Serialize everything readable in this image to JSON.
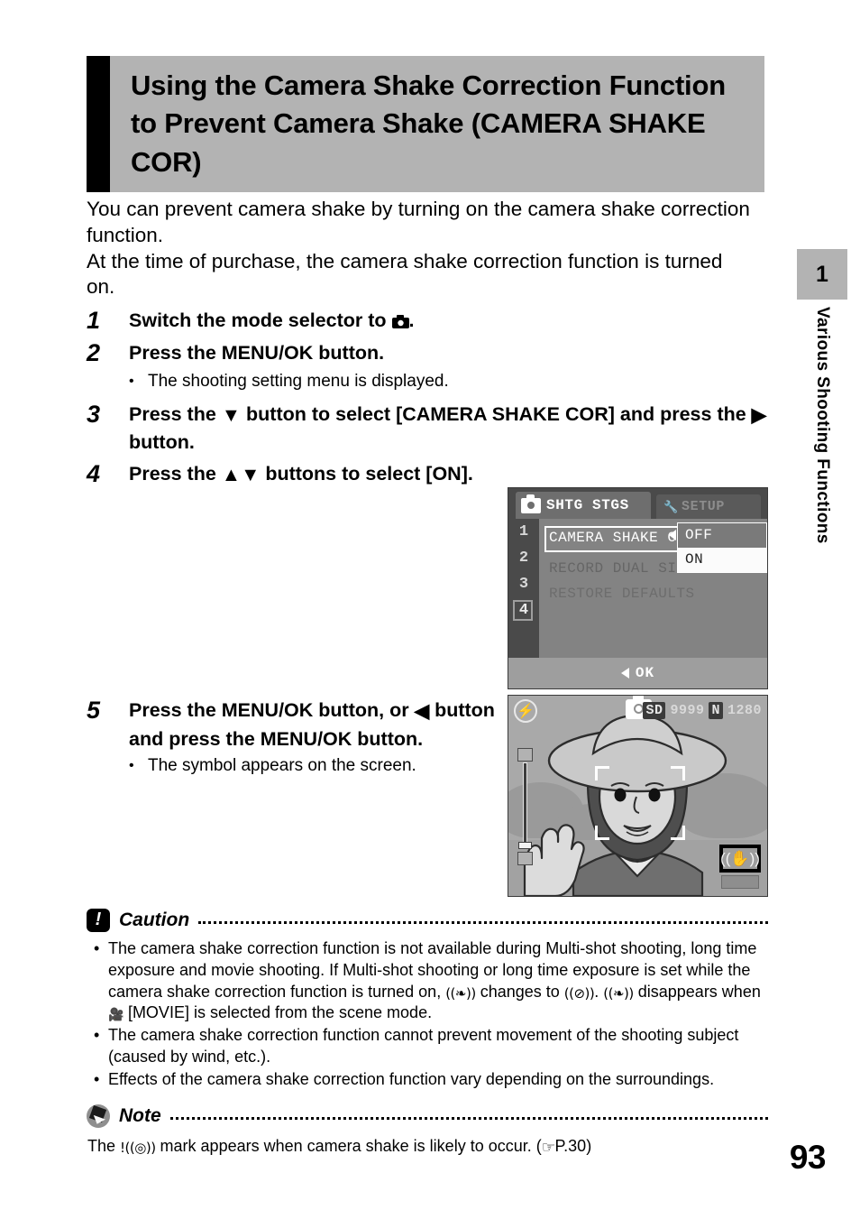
{
  "header": {
    "title": "Using the Camera Shake Correction Function to Prevent Camera Shake (CAMERA SHAKE COR)"
  },
  "intro": {
    "line1": "You can prevent camera shake by turning on the camera shake correction function.",
    "line2": "At the time of purchase, the camera shake correction function is turned on."
  },
  "steps": [
    {
      "num": "1",
      "text_before": "Switch the mode selector to ",
      "icon": "still-camera-icon",
      "text_after": "."
    },
    {
      "num": "2",
      "text": "Press the MENU/OK button.",
      "note_bullet": "•",
      "note": "The shooting setting menu is displayed."
    },
    {
      "num": "3",
      "text_part1": "Press the ",
      "icon1": "triangle-down-icon",
      "text_part2": " button to select [CAMERA SHAKE COR] and press the ",
      "icon2": "triangle-right-icon",
      "text_part3": " button."
    },
    {
      "num": "4",
      "text_part1": "Press the ",
      "icon1": "triangle-up-icon",
      "icon2": "triangle-down-icon",
      "text_part2": " buttons to select [ON]."
    },
    {
      "num": "5",
      "text_part1": "Press the MENU/OK button, or ",
      "icon1": "triangle-left-icon",
      "text_part2": " button and press the MENU/OK button.",
      "note_bullet": "•",
      "note": "The symbol appears on the screen."
    }
  ],
  "lcd_menu": {
    "tab_active": "SHTG STGS",
    "tab_inactive": "SETUP",
    "rail": [
      "1",
      "2",
      "3",
      "4"
    ],
    "selected_rail": "4",
    "items": [
      "CAMERA SHAKE COR",
      "RECORD DUAL SIZE",
      "RESTORE DEFAULTS"
    ],
    "submenu_options": [
      "OFF",
      "ON"
    ],
    "submenu_selected": "ON",
    "footer": "OK"
  },
  "lcd_viewfinder": {
    "indicators": [
      "SD",
      "9999",
      "N",
      "1280"
    ],
    "flash_icon": "flash-off-icon",
    "mode_icon": "still-camera-icon",
    "shake_badge_icon": "camera-shake-icon"
  },
  "caution": {
    "title": "Caution",
    "bullet": "•",
    "items": [
      {
        "p1": "The camera shake correction function is not available during Multi-shot shooting, long time exposure and movie shooting. If Multi-shot shooting or long time exposure is set while the camera shake correction function is turned on, ",
        "icon1": "camera-shake-icon",
        "p2": " changes to ",
        "icon2": "camera-shake-off-icon",
        "p3": ". ",
        "icon3": "camera-shake-icon",
        "p4": " disappears when ",
        "icon4": "movie-icon",
        "p5": " [MOVIE] is selected from the scene mode."
      },
      {
        "p1": "The camera shake correction function cannot prevent movement of the shooting subject (caused by wind, etc.)."
      },
      {
        "p1": "Effects of the camera shake correction function vary depending on the surroundings."
      }
    ]
  },
  "note": {
    "title": "Note",
    "text_p1": "The ",
    "icon1": "camera-shake-warning-icon",
    "text_p2": " mark appears when camera shake is likely to occur. (",
    "icon2": "pointing-hand-icon",
    "text_p3": "P.30)"
  },
  "sidebar": {
    "chapter_number": "1",
    "chapter_label": "Various Shooting Functions"
  },
  "page_number": "93",
  "colors": {
    "banner_bg": "#b3b3b3",
    "banner_bar": "#000000",
    "lcd_bg": "#9a9a9a"
  }
}
